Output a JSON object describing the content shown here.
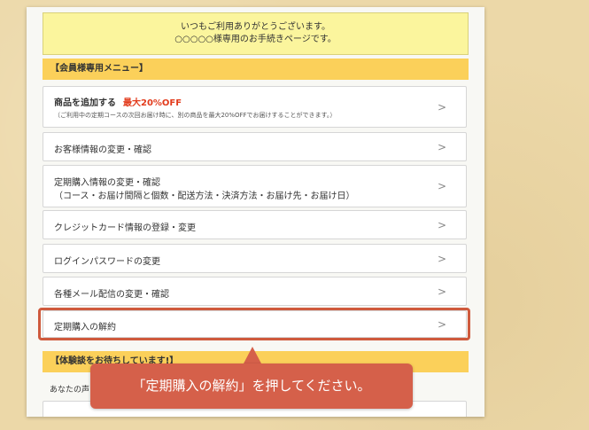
{
  "notice": {
    "line1": "いつもご利用ありがとうございます。",
    "line2": "○○○○○様専用のお手続きページです。"
  },
  "member_menu": {
    "header": "【会員様専用メニュー】",
    "items": [
      {
        "label": "商品を追加する",
        "badge": "最大20%OFF",
        "note": "（ご利用中の定期コースの次回お届け時に、別の商品を最大20%OFFでお届けすることができます。）"
      },
      {
        "label": "お客様情報の変更・確認"
      },
      {
        "label": "定期購入情報の変更・確認",
        "sub": "（コース・お届け間隔と個数・配送方法・決済方法・お届け先・お届け日）"
      },
      {
        "label": "クレジットカード情報の登録・変更"
      },
      {
        "label": "ログインパスワードの変更"
      },
      {
        "label": "各種メール配信の変更・確認"
      },
      {
        "label": "定期購入の解約"
      }
    ],
    "chevron": ">"
  },
  "review_section": {
    "header": "【体験談をお待ちしています!】",
    "text": "あなたの声"
  },
  "callout": {
    "text": "「定期購入の解約」を押してください。"
  },
  "colors": {
    "accent_red": "#e23b1c",
    "highlight": "#cf5a3d",
    "section_bar": "#fbd05a"
  }
}
